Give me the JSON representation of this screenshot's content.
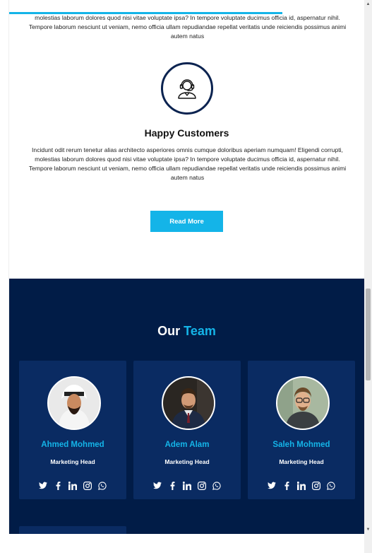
{
  "services": {
    "top_paragraph": "molestias laborum dolores quod nisi vitae voluptate ipsa? In tempore voluptate ducimus officia id, aspernatur nihil. Tempore laborum nesciunt ut veniam, nemo officia ullam repudiandae repellat veritatis unde reiciendis possimus animi autem natus",
    "item_title": "Happy Customers",
    "item_paragraph": "Incidunt odit rerum tenetur alias architecto asperiores omnis cumque doloribus aperiam numquam! Eligendi corrupti, molestias laborum dolores quod nisi vitae voluptate ipsa? In tempore voluptate ducimus officia id, aspernatur nihil. Tempore laborum nesciunt ut veniam, nemo officia ullam repudiandae repellat veritatis unde reiciendis possimus animi autem natus",
    "item_icon": "customer-support-headset-icon",
    "read_more_label": "Read More"
  },
  "team": {
    "title_prefix": "Our",
    "title_accent": "Team",
    "members": [
      {
        "name": "Ahmed Mohmed",
        "role": "Marketing Head"
      },
      {
        "name": "Adem Alam",
        "role": "Marketing Head"
      },
      {
        "name": "Saleh Mohmed",
        "role": "Marketing Head"
      }
    ],
    "social_icons": [
      "twitter-icon",
      "facebook-icon",
      "linkedin-icon",
      "instagram-icon",
      "whatsapp-icon"
    ]
  },
  "colors": {
    "accent": "#14b4e8",
    "navy": "#011c47",
    "card": "#0a2b62"
  }
}
